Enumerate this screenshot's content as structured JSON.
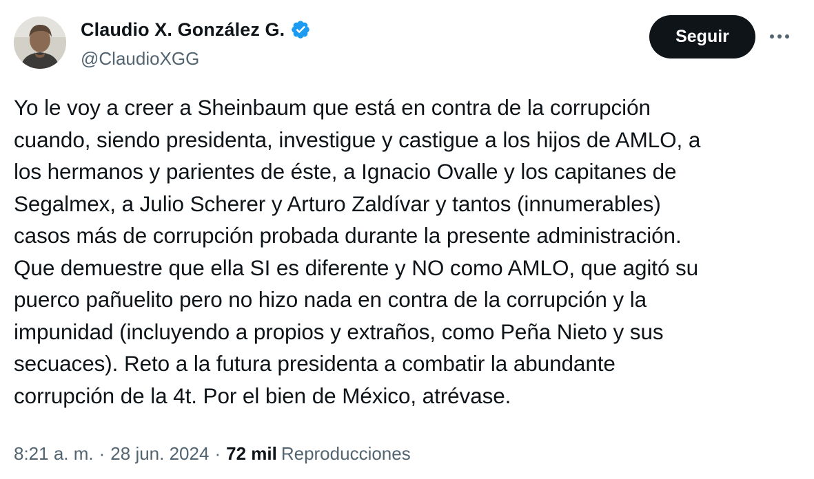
{
  "author": {
    "display_name": "Claudio X. González G.",
    "handle": "@ClaudioXGG",
    "verified_color": "#1d9bf0"
  },
  "actions": {
    "follow_label": "Seguir",
    "more_icon": "more-horizontal-icon"
  },
  "tweet": {
    "lines": [
      "Yo le voy a creer a Sheinbaum que está en contra de la corrupción",
      "cuando, siendo presidenta, investigue y castigue a los hijos de AMLO, a",
      "los hermanos y parientes de éste, a Ignacio Ovalle y los capitanes de",
      "Segalmex, a Julio Scherer y Arturo Zaldívar y tantos (innumerables)",
      "casos más de corrupción probada durante la presente administración.",
      "Que demuestre que ella SI es diferente y NO como AMLO, que agitó su",
      "puerco pañuelito pero no hizo nada en contra de la corrupción y la",
      "impunidad (incluyendo a propios y extraños, como Peña Nieto y sus",
      "secuaces). Reto a la futura presidenta a combatir la abundante",
      "corrupción de la 4t. Por el bien de México, atrévase."
    ]
  },
  "meta": {
    "time": "8:21 a. m.",
    "separator": "·",
    "date": "28 jun. 2024",
    "views_count": "72 mil",
    "views_label": "Reproducciones"
  },
  "colors": {
    "text_primary": "#0f1419",
    "text_secondary": "#536471",
    "button_bg": "#0f1419",
    "button_text": "#ffffff"
  }
}
